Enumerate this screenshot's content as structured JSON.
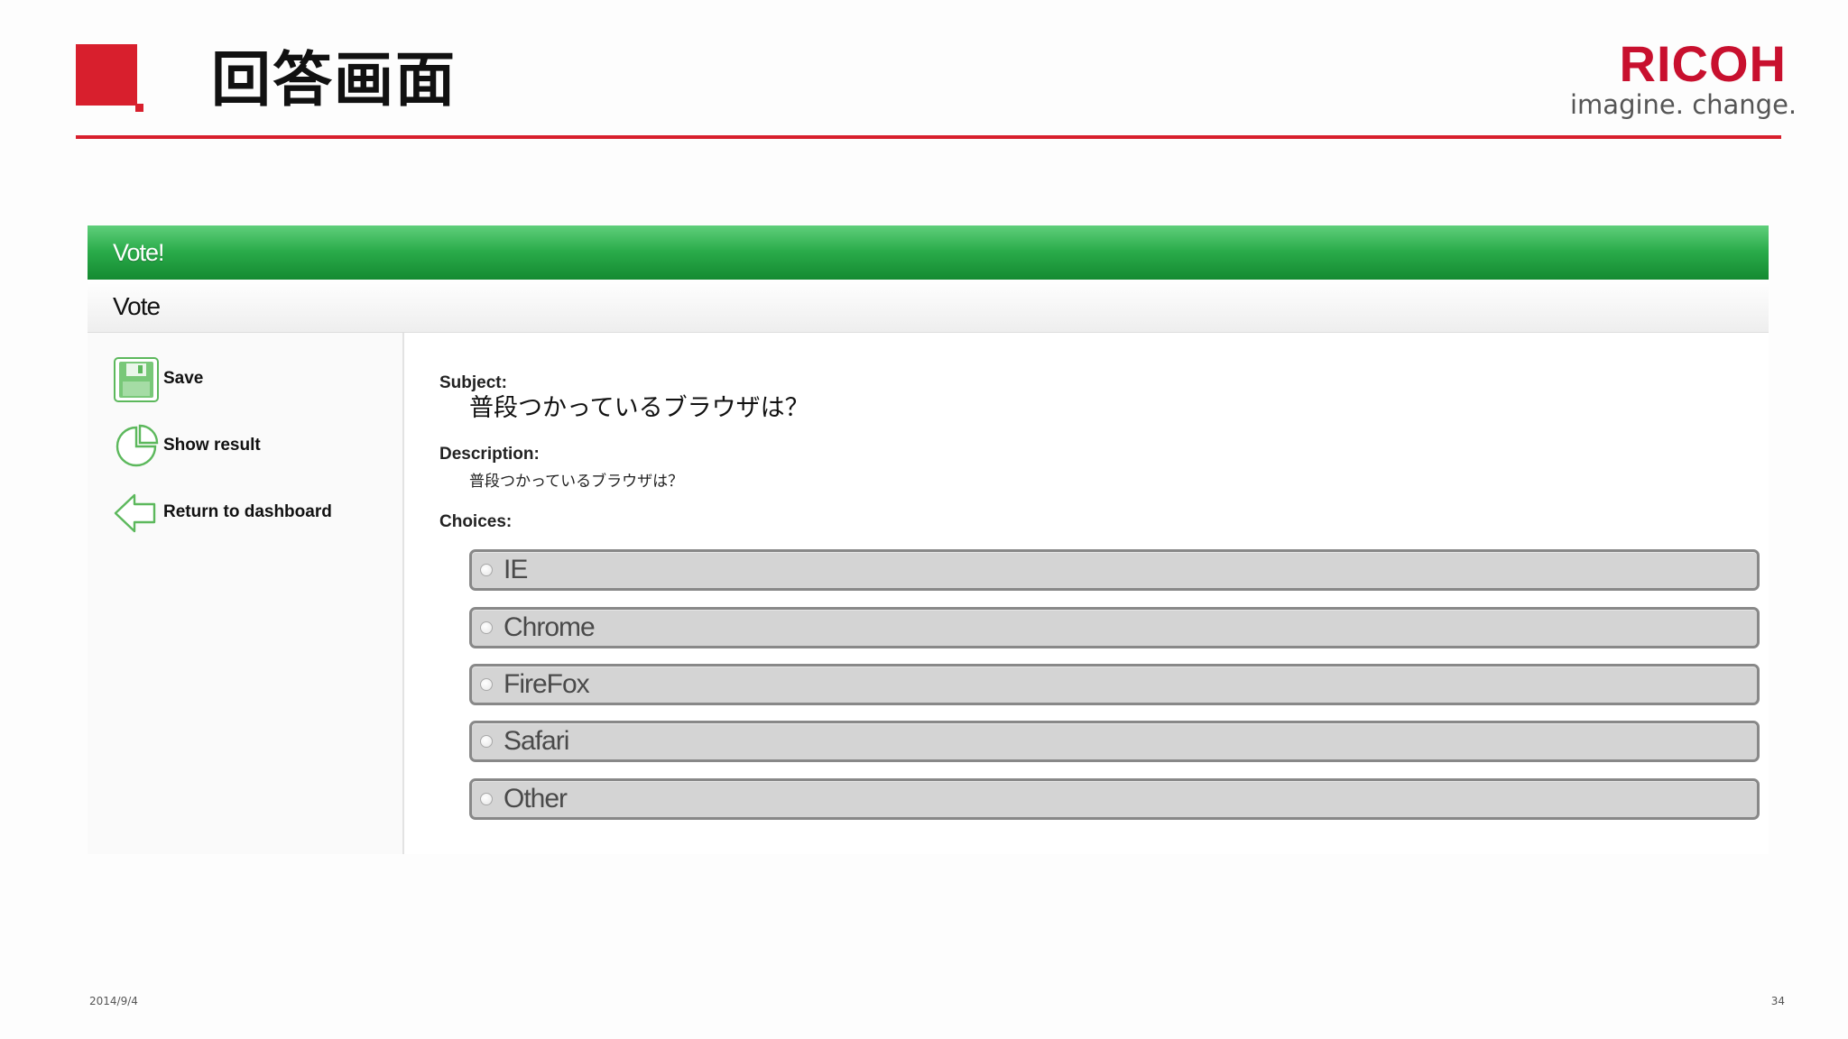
{
  "slide": {
    "title": "回答画面",
    "brand": {
      "name": "RICOH",
      "tagline": "imagine. change."
    },
    "footer": {
      "date": "2014/9/4",
      "page": "34"
    }
  },
  "app": {
    "title": "Vote!",
    "page_heading": "Vote",
    "sidebar": {
      "actions": [
        {
          "label": "Save",
          "icon": "save-icon"
        },
        {
          "label": "Show result",
          "icon": "pie-chart-icon"
        },
        {
          "label": "Return to dashboard",
          "icon": "back-arrow-icon"
        }
      ]
    },
    "form": {
      "subject_label": "Subject:",
      "subject": "普段つかっているブラウザは？",
      "description_label": "Description:",
      "description": "普段つかっているブラウザは？",
      "choices_label": "Choices:",
      "choices": [
        "IE",
        "Chrome",
        "FireFox",
        "Safari",
        "Other"
      ]
    }
  },
  "colors": {
    "brand_red": "#d81f2d",
    "titlebar_green": "#2aab4a",
    "icon_green": "#5cb85c",
    "choice_background": "#d4d4d4"
  }
}
